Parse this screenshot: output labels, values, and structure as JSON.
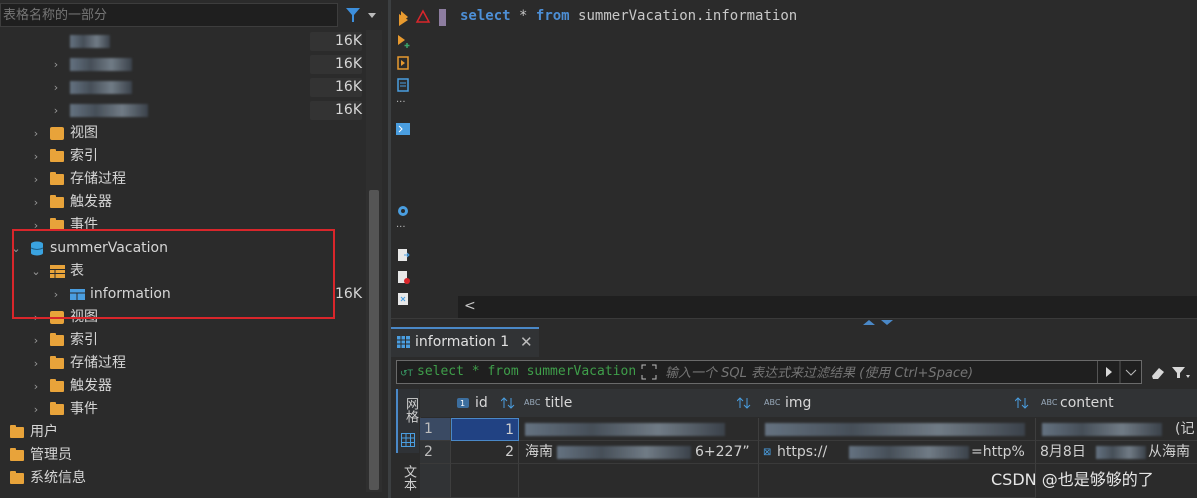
{
  "navigator": {
    "filter_placeholder": "表格名称的一部分",
    "sizes": [
      "16K",
      "16K",
      "16K",
      "16K"
    ],
    "items_db1": [
      "视图",
      "索引",
      "存储过程",
      "触发器",
      "事件"
    ],
    "database": "summerVacation",
    "tables_folder": "表",
    "table": "information",
    "table_size": "16K",
    "items_db2": [
      "视图",
      "索引",
      "存储过程",
      "触发器",
      "事件"
    ],
    "root_items": [
      "用户",
      "管理员",
      "系统信息"
    ]
  },
  "editor": {
    "kw_select": "select",
    "star": "*",
    "kw_from": "from",
    "target": "summerVacation.information",
    "hscroll_left": "<"
  },
  "results": {
    "tab_label": "information 1",
    "close": "✕",
    "filter_sql": "select * from summerVacation",
    "filter_placeholder": "输入一个 SQL 表达式来过滤结果 (使用 Ctrl+Space)",
    "side_tab": "网格",
    "side_tab2": "文本",
    "columns": [
      {
        "type": "",
        "name": "id"
      },
      {
        "type": "ABC",
        "name": "title"
      },
      {
        "type": "ABC",
        "name": "img"
      },
      {
        "type": "ABC",
        "name": "content"
      }
    ],
    "rows": [
      {
        "num": "1",
        "id": "1",
        "title": "",
        "img": "",
        "content": "(记"
      },
      {
        "num": "2",
        "id": "2",
        "title": "海南",
        "title_tail": "6+227”",
        "img": "https://",
        "img_tail": "=http%",
        "content": "8月8日",
        "content_tail": "从海南"
      }
    ]
  },
  "watermark": "CSDN @也是够够的了",
  "colors": {
    "accent": "#4a88c7",
    "keyword": "#4d8fd6",
    "highlight": "#d9262b",
    "folder": "#e8a33a"
  }
}
